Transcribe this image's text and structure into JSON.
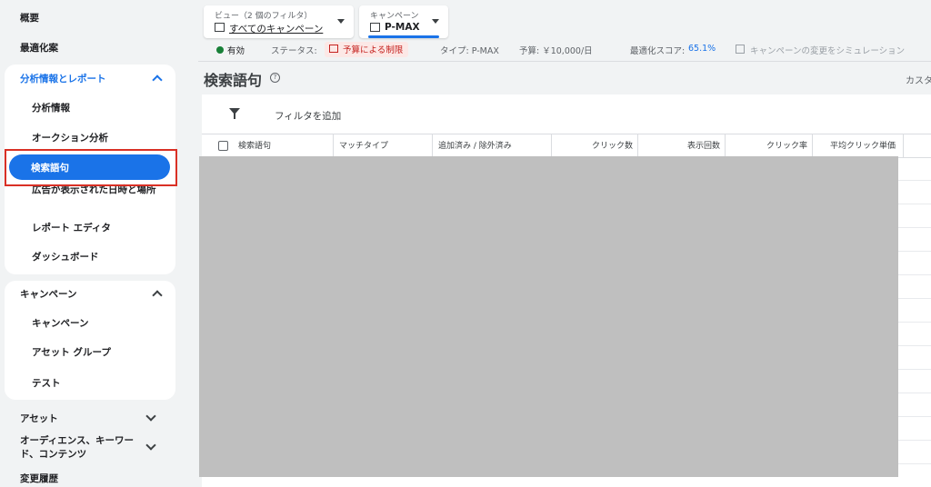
{
  "sidebar": {
    "overview": "概要",
    "recommendations": "最適化案",
    "insights_section": {
      "label": "分析情報とレポート",
      "items": [
        "分析情報",
        "オークション分析",
        "検索語句",
        "広告が表示された日時と場所",
        "レポート エディタ",
        "ダッシュボード"
      ],
      "active": "検索語句"
    },
    "campaigns_section": {
      "label": "キャンペーン",
      "items": [
        "キャンペーン",
        "アセット グループ",
        "テスト"
      ]
    },
    "assets": "アセット",
    "audiences": "オーディエンス、キーワード、コンテンツ",
    "change_history": "変更履歴"
  },
  "header": {
    "view_selector": {
      "label": "ビュー（2 個のフィルタ）",
      "value": "すべてのキャンペーン"
    },
    "campaign_selector": {
      "label": "キャンペーン",
      "value": "P-MAX"
    },
    "status_row": {
      "enabled": "有効",
      "status_label": "ステータス:",
      "status_value": "予算による制限",
      "type": "タイプ: P-MAX",
      "budget": "予算: ￥10,000/日",
      "score_label": "最適化スコア:",
      "score_value": "65.1%",
      "simulate": "キャンペーンの変更をシミュレーション"
    }
  },
  "page": {
    "title": "検索語句",
    "custom_link": "カスタ"
  },
  "table": {
    "filter_label": "フィルタを追加",
    "columns": [
      "検索語句",
      "マッチタイプ",
      "追加済み / 除外済み",
      "クリック数",
      "表示回数",
      "クリック率",
      "平均クリック単価"
    ]
  },
  "colors": {
    "accent": "#1a73e8",
    "alert_red": "#d93025",
    "enabled_green": "#188038"
  }
}
